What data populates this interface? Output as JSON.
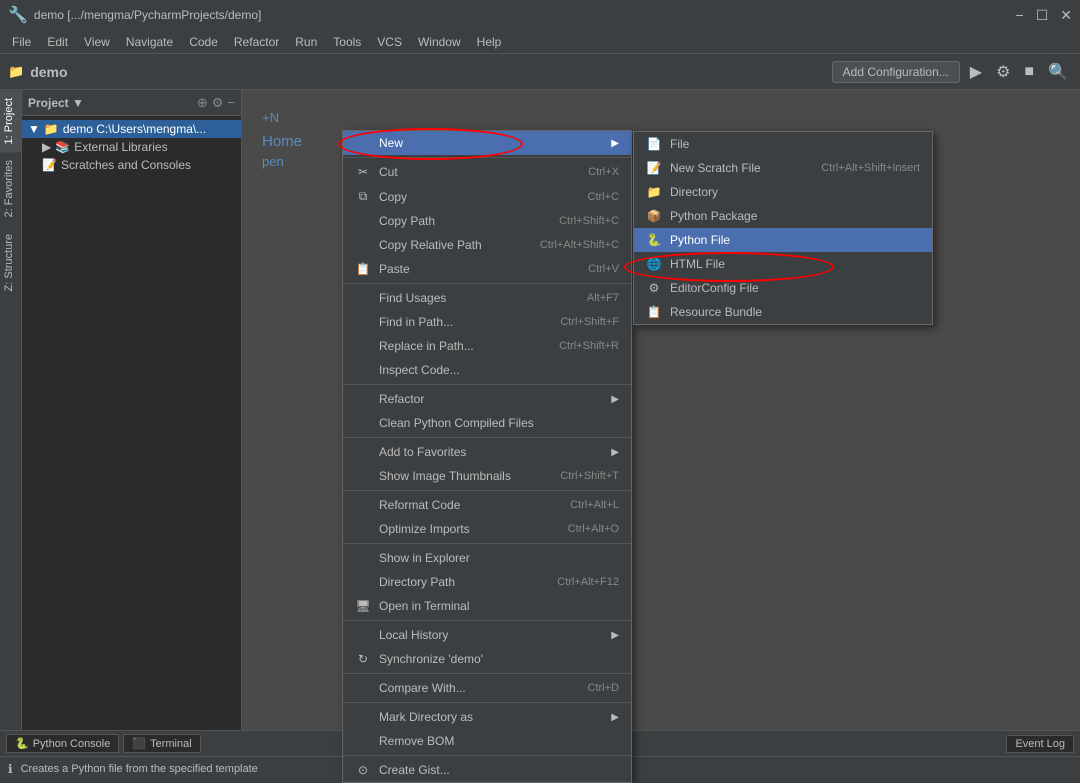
{
  "titlebar": {
    "title": "demo [.../mengma/PycharmProjects/demo]",
    "minimize": "−",
    "maximize": "☐",
    "close": "✕"
  },
  "menubar": {
    "items": [
      "File",
      "Edit",
      "View",
      "Navigate",
      "Code",
      "Refactor",
      "Run",
      "Tools",
      "VCS",
      "Window",
      "Help"
    ]
  },
  "toolbar": {
    "project_name": "demo",
    "run_config_btn": "Add Configuration...",
    "run_icon": "▶",
    "debug_icon": "⚙",
    "stop_icon": "■",
    "search_icon": "🔍"
  },
  "project_panel": {
    "header": "Project",
    "tree": [
      {
        "label": "demo C:\\Users\\mengma\\...\\demo",
        "indent": 0,
        "type": "folder",
        "selected": true
      },
      {
        "label": "External Libraries",
        "indent": 1,
        "type": "folder"
      },
      {
        "label": "Scratches and Consoles",
        "indent": 1,
        "type": "scratches"
      }
    ]
  },
  "side_tabs": [
    {
      "label": "1: Project",
      "active": true
    },
    {
      "label": "2: Favorites"
    },
    {
      "label": "Z: Structure"
    }
  ],
  "context_menu": {
    "items": [
      {
        "label": "New",
        "shortcut": "",
        "arrow": "▶",
        "highlighted": true,
        "icon": ""
      },
      {
        "label": "Cut",
        "shortcut": "Ctrl+X",
        "icon": "✂"
      },
      {
        "label": "Copy",
        "shortcut": "Ctrl+C",
        "icon": "⧉"
      },
      {
        "label": "Copy Path",
        "shortcut": "Ctrl+Shift+C",
        "icon": ""
      },
      {
        "label": "Copy Relative Path",
        "shortcut": "Ctrl+Alt+Shift+C",
        "icon": ""
      },
      {
        "label": "Paste",
        "shortcut": "Ctrl+V",
        "icon": "📋"
      },
      {
        "sep": true
      },
      {
        "label": "Find Usages",
        "shortcut": "Alt+F7",
        "icon": ""
      },
      {
        "label": "Find in Path...",
        "shortcut": "Ctrl+Shift+F",
        "icon": ""
      },
      {
        "label": "Replace in Path...",
        "shortcut": "Ctrl+Shift+R",
        "icon": ""
      },
      {
        "label": "Inspect Code...",
        "shortcut": "",
        "icon": ""
      },
      {
        "sep": true
      },
      {
        "label": "Refactor",
        "shortcut": "",
        "arrow": "▶",
        "icon": ""
      },
      {
        "label": "Clean Python Compiled Files",
        "shortcut": "",
        "icon": ""
      },
      {
        "sep": true
      },
      {
        "label": "Add to Favorites",
        "shortcut": "",
        "arrow": "▶",
        "icon": ""
      },
      {
        "label": "Show Image Thumbnails",
        "shortcut": "Ctrl+Shift+T",
        "icon": ""
      },
      {
        "sep": true
      },
      {
        "label": "Reformat Code",
        "shortcut": "Ctrl+Alt+L",
        "icon": ""
      },
      {
        "label": "Optimize Imports",
        "shortcut": "Ctrl+Alt+O",
        "icon": ""
      },
      {
        "sep": true
      },
      {
        "label": "Show in Explorer",
        "shortcut": "",
        "icon": ""
      },
      {
        "label": "Directory Path",
        "shortcut": "Ctrl+Alt+F12",
        "icon": ""
      },
      {
        "label": "Open in Terminal",
        "shortcut": "",
        "icon": "🖥"
      },
      {
        "sep": true
      },
      {
        "label": "Local History",
        "shortcut": "",
        "arrow": "▶",
        "icon": ""
      },
      {
        "label": "Synchronize 'demo'",
        "shortcut": "",
        "icon": "↻"
      },
      {
        "sep": true
      },
      {
        "label": "Compare With...",
        "shortcut": "Ctrl+D",
        "icon": ""
      },
      {
        "sep": true
      },
      {
        "label": "Mark Directory as",
        "shortcut": "",
        "arrow": "▶",
        "icon": ""
      },
      {
        "label": "Remove BOM",
        "shortcut": "",
        "icon": ""
      },
      {
        "sep": true
      },
      {
        "label": "Create Gist...",
        "shortcut": "",
        "icon": "⊙"
      }
    ]
  },
  "submenu": {
    "items": [
      {
        "label": "File",
        "shortcut": "",
        "icon": "📄"
      },
      {
        "label": "New Scratch File",
        "shortcut": "Ctrl+Alt+Shift+Insert",
        "icon": "📝"
      },
      {
        "label": "Directory",
        "shortcut": "",
        "icon": "📁"
      },
      {
        "label": "Python Package",
        "shortcut": "",
        "icon": "📦"
      },
      {
        "label": "Python File",
        "shortcut": "",
        "icon": "🐍",
        "highlighted": true
      },
      {
        "label": "HTML File",
        "shortcut": "",
        "icon": "🌐"
      },
      {
        "label": "EditorConfig File",
        "shortcut": "",
        "icon": "⚙"
      },
      {
        "label": "Resource Bundle",
        "shortcut": "",
        "icon": "📋"
      }
    ]
  },
  "content": {
    "shortcut_label": "+N",
    "home_text": "Home",
    "open_text": "pen"
  },
  "status_bar": {
    "message": "Creates a Python file from the specified template"
  },
  "bottom": {
    "python_console": "Python Console",
    "terminal": "Terminal",
    "event_log": "Event Log"
  }
}
